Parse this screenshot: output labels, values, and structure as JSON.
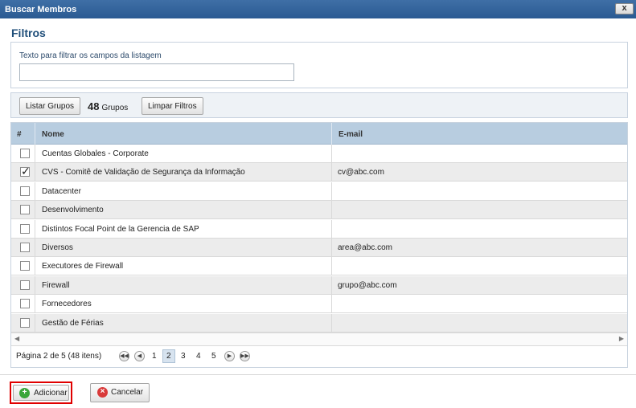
{
  "window": {
    "title": "Buscar Membros",
    "close_label": "x"
  },
  "filters": {
    "title": "Filtros",
    "label": "Texto para filtrar os campos da listagem",
    "value": ""
  },
  "toolbar": {
    "list_groups_label": "Listar Grupos",
    "count": "48",
    "count_unit": "Grupos",
    "clear_filters_label": "Limpar Filtros"
  },
  "grid": {
    "columns": [
      "#",
      "Nome",
      "E-mail"
    ],
    "rows": [
      {
        "checked": false,
        "name": "Cuentas Globales - Corporate",
        "email": ""
      },
      {
        "checked": true,
        "name": "CVS - Comitê de Validação de Segurança da Informação",
        "email": "cv@abc.com"
      },
      {
        "checked": false,
        "name": "Datacenter",
        "email": ""
      },
      {
        "checked": false,
        "name": "Desenvolvimento",
        "email": ""
      },
      {
        "checked": false,
        "name": "Distintos Focal Point de la Gerencia de SAP",
        "email": ""
      },
      {
        "checked": false,
        "name": "Diversos",
        "email": "area@abc.com"
      },
      {
        "checked": false,
        "name": "Executores de Firewall",
        "email": ""
      },
      {
        "checked": false,
        "name": "Firewall",
        "email": "grupo@abc.com"
      },
      {
        "checked": false,
        "name": "Fornecedores",
        "email": ""
      },
      {
        "checked": false,
        "name": "Gestão de Férias",
        "email": ""
      }
    ]
  },
  "pager": {
    "summary": "Página 2 de 5 (48 itens)",
    "pages": [
      "1",
      "2",
      "3",
      "4",
      "5"
    ],
    "current_page": "2",
    "first_icon": "first-page-icon",
    "prev_icon": "prev-page-icon",
    "next_icon": "next-page-icon",
    "last_icon": "last-page-icon"
  },
  "footer": {
    "add_label": "Adicionar",
    "cancel_label": "Cancelar",
    "add_icon": "plus-circle-icon",
    "cancel_icon": "x-circle-icon",
    "add_color": "#3aa63a",
    "cancel_color": "#d93a3a",
    "highlight_color": "#e00000"
  }
}
